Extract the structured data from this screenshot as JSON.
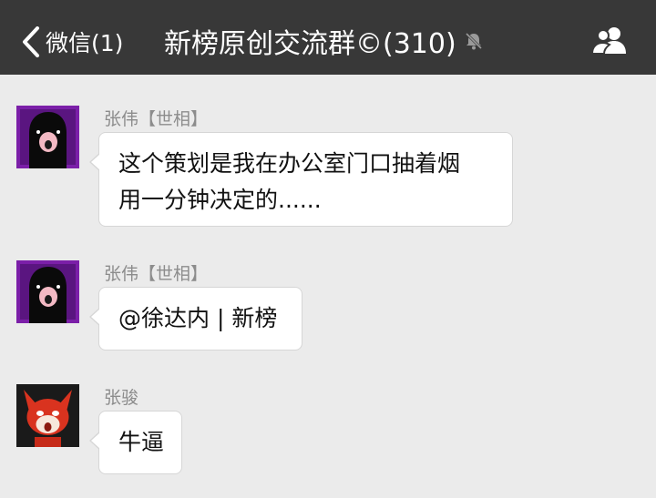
{
  "navbar": {
    "back_label": "微信(1)",
    "title": "新榜原创交流群©(310)",
    "back_icon": "chevron-left-icon",
    "mute_icon": "bell-muted-icon",
    "members_icon": "group-members-icon",
    "bg_color": "#383838"
  },
  "messages": [
    {
      "sender": "张伟【世相】",
      "avatar_icon": "black-bird-avatar",
      "lines": [
        "这个策划是我在办公室门口抽着烟",
        "用一分钟决定的......"
      ]
    },
    {
      "sender": "张伟【世相】",
      "avatar_icon": "black-bird-avatar",
      "lines": [
        "@徐达内 | 新榜"
      ]
    },
    {
      "sender": "张骏",
      "avatar_icon": "red-fox-avatar",
      "lines": [
        "牛逼"
      ]
    }
  ]
}
